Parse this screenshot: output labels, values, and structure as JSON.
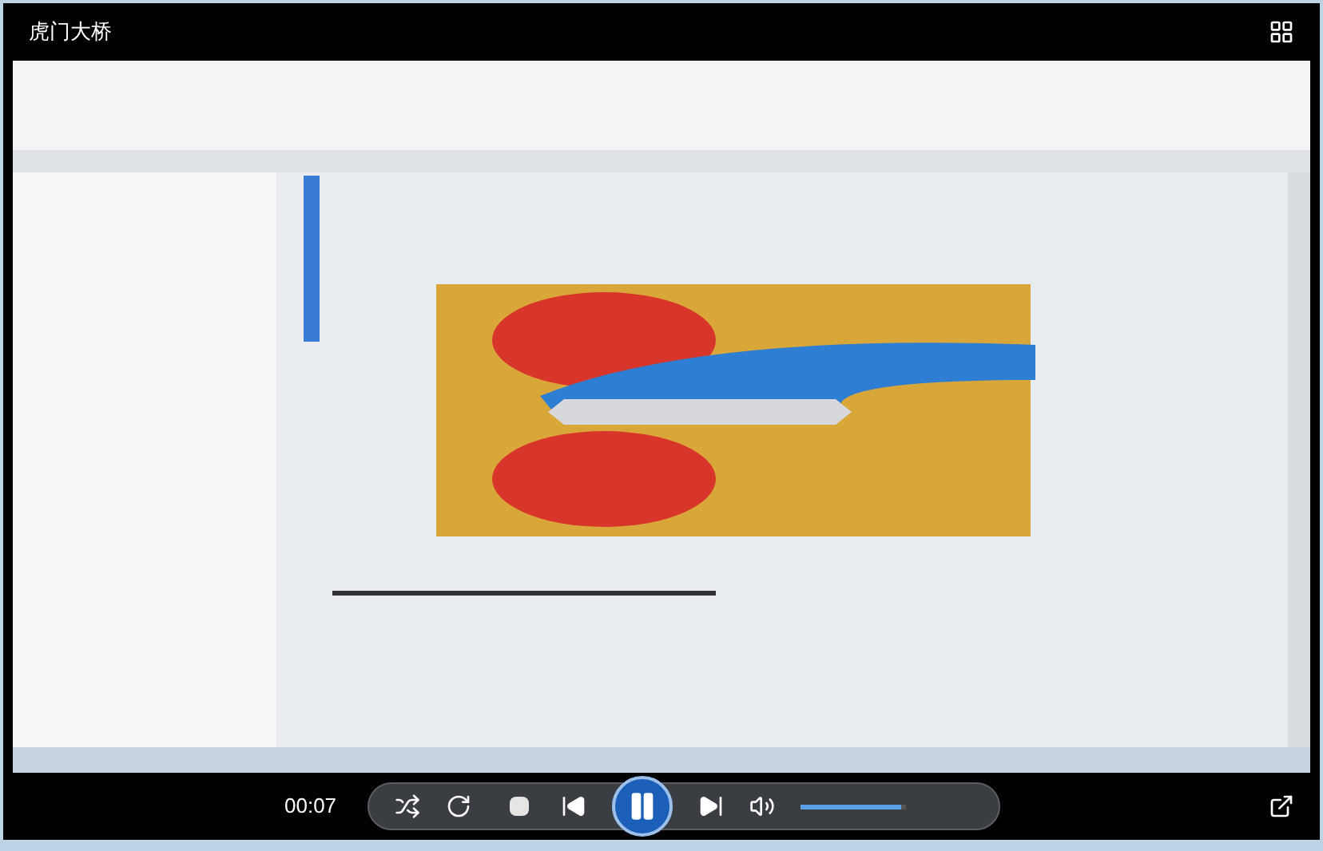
{
  "window": {
    "title": "虎门大桥"
  },
  "controls": {
    "time": "00:07",
    "playing": true,
    "volume": {
      "level": 0.95
    }
  }
}
